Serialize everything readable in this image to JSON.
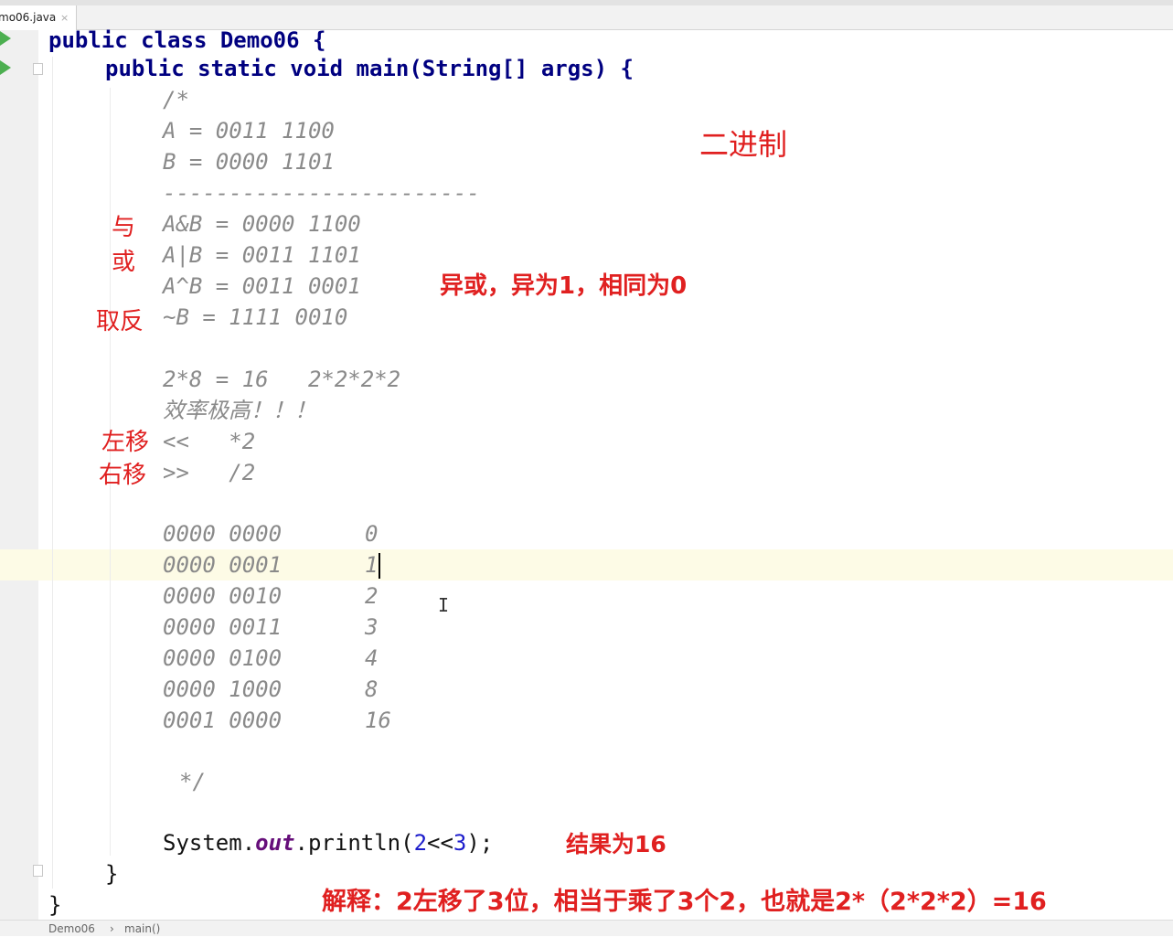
{
  "tab": {
    "label": "mo06.java",
    "close": "×"
  },
  "code": {
    "class_decl": "public class Demo06 {",
    "main_decl": "public static void main(String[] args) {",
    "comment_open": "/*",
    "a_def": "A = 0011 1100",
    "b_def": "B = 0000 1101",
    "dashes": "------------------------",
    "and_line": "A&B = 0000 1100",
    "or_line": "A|B = 0011 1101",
    "xor_line": "A^B = 0011 0001",
    "not_line": "~B = 1111 0010",
    "mult_line": "2*8 = 16   2*2*2*2",
    "efficiency": "效率极高！！！",
    "shl_line": "<<   *2",
    "shr_line": ">>   /2",
    "binary_table": [
      {
        "bits": "0000 0000",
        "value": "0"
      },
      {
        "bits": "0000 0001",
        "value": "1"
      },
      {
        "bits": "0000 0010",
        "value": "2"
      },
      {
        "bits": "0000 0011",
        "value": "3"
      },
      {
        "bits": "0000 0100",
        "value": "4"
      },
      {
        "bits": "0000 1000",
        "value": "8"
      },
      {
        "bits": "0001 0000",
        "value": "16"
      }
    ],
    "comment_close": "*/",
    "println": {
      "prefix": "System.",
      "field": "out",
      "method": ".println(",
      "arg1": "2",
      "op": "<<",
      "arg2": "3",
      "suffix": ");"
    },
    "close_method": "}",
    "close_class": "}"
  },
  "annotations": {
    "binary": "二进制",
    "and": "与",
    "or": "或",
    "xor_note": "异或，异为1，相同为0",
    "not": "取反",
    "shift_left": "左移",
    "shift_right": "右移",
    "result": "结果为16",
    "explanation": "解释：2左移了3位，相当于乘了3个2，也就是2*（2*2*2）=16"
  },
  "breadcrumb": {
    "class": "Demo06",
    "separator": "›",
    "method": "main()"
  },
  "colors": {
    "keyword": "#000080",
    "comment": "#8a8a8a",
    "annotation": "#e02020",
    "number": "#1c1ccc",
    "field": "#660e7a",
    "current_line": "#fdfbe6"
  }
}
